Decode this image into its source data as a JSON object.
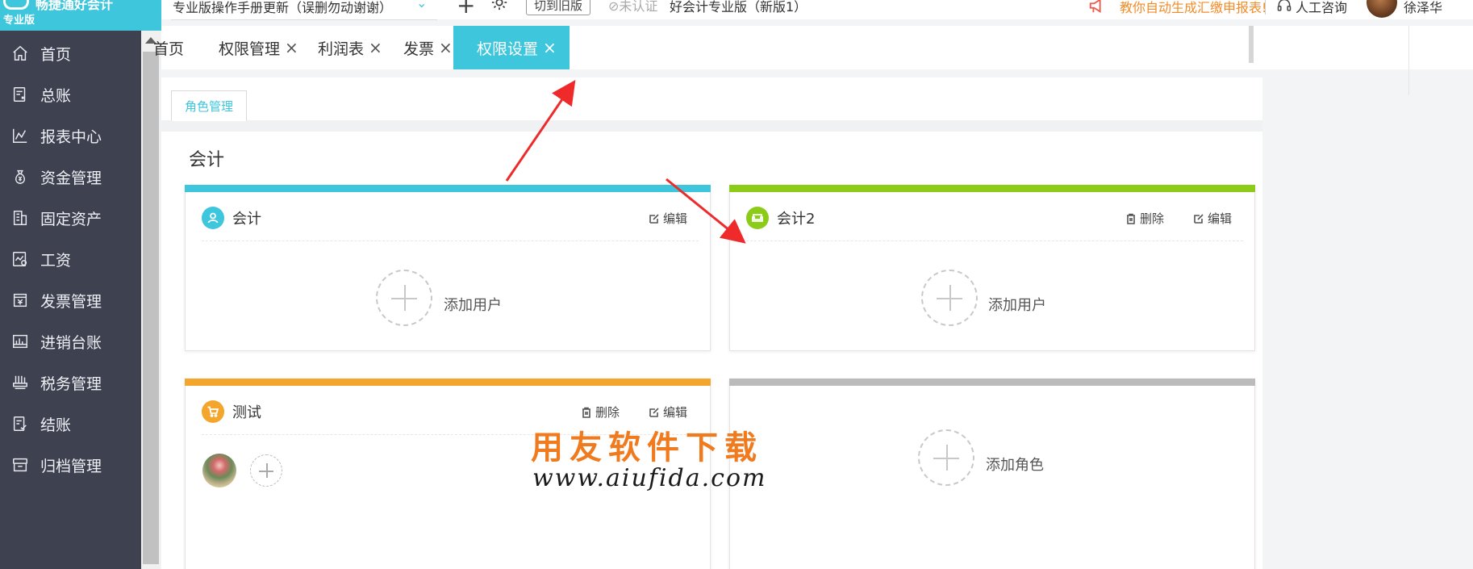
{
  "app": {
    "logo_text": "畅捷通好会计",
    "logo_sub": "专业版"
  },
  "header": {
    "notice_select": "专业版操作手册更新（误删勿动谢谢）",
    "switch_old_label": "切到旧版",
    "cert_label": "未认证",
    "product_name": "好会计专业版（新版1）",
    "promo_text": "教你自动生成汇缴申报表!",
    "service_label": "人工咨询",
    "user_name": "徐泽华"
  },
  "sidebar": {
    "items": [
      {
        "label": "首页",
        "icon": "home-icon"
      },
      {
        "label": "总账",
        "icon": "ledger-icon"
      },
      {
        "label": "报表中心",
        "icon": "report-chart-icon"
      },
      {
        "label": "资金管理",
        "icon": "money-bag-icon"
      },
      {
        "label": "固定资产",
        "icon": "building-icon"
      },
      {
        "label": "工资",
        "icon": "salary-icon"
      },
      {
        "label": "发票管理",
        "icon": "invoice-icon"
      },
      {
        "label": "进销台账",
        "icon": "inventory-icon"
      },
      {
        "label": "税务管理",
        "icon": "tax-icon"
      },
      {
        "label": "结账",
        "icon": "close-account-icon"
      },
      {
        "label": "归档管理",
        "icon": "archive-icon"
      }
    ]
  },
  "tabs": [
    {
      "label": "首页",
      "closable": false,
      "active": false
    },
    {
      "label": "权限管理",
      "closable": true,
      "active": false
    },
    {
      "label": "利润表",
      "closable": true,
      "active": false
    },
    {
      "label": "发票",
      "closable": true,
      "active": false
    },
    {
      "label": "权限设置",
      "closable": true,
      "active": true
    }
  ],
  "close_glyph": "×",
  "subtab": {
    "label": "角色管理"
  },
  "section": {
    "title": "会计"
  },
  "labels": {
    "edit": "编辑",
    "delete": "删除",
    "add_user": "添加用户",
    "add_role": "添加角色"
  },
  "cards": [
    {
      "name": "会计",
      "color": "#3ec6dc",
      "icon": "user-icon"
    },
    {
      "name": "会计2",
      "color": "#8ccb18",
      "icon": "sofa-icon"
    },
    {
      "name": "测试",
      "color": "#f4a52b",
      "icon": "cart-icon"
    },
    {
      "name": "",
      "color": "#bbbbbb"
    }
  ],
  "watermark": {
    "line1": "用友软件下载",
    "line2": "www.aiufida.com"
  },
  "colors": {
    "accent": "#3ec6dc",
    "sidebar_bg": "#3d4150",
    "promo": "#f28c28",
    "arrow": "#ee2a2a"
  }
}
